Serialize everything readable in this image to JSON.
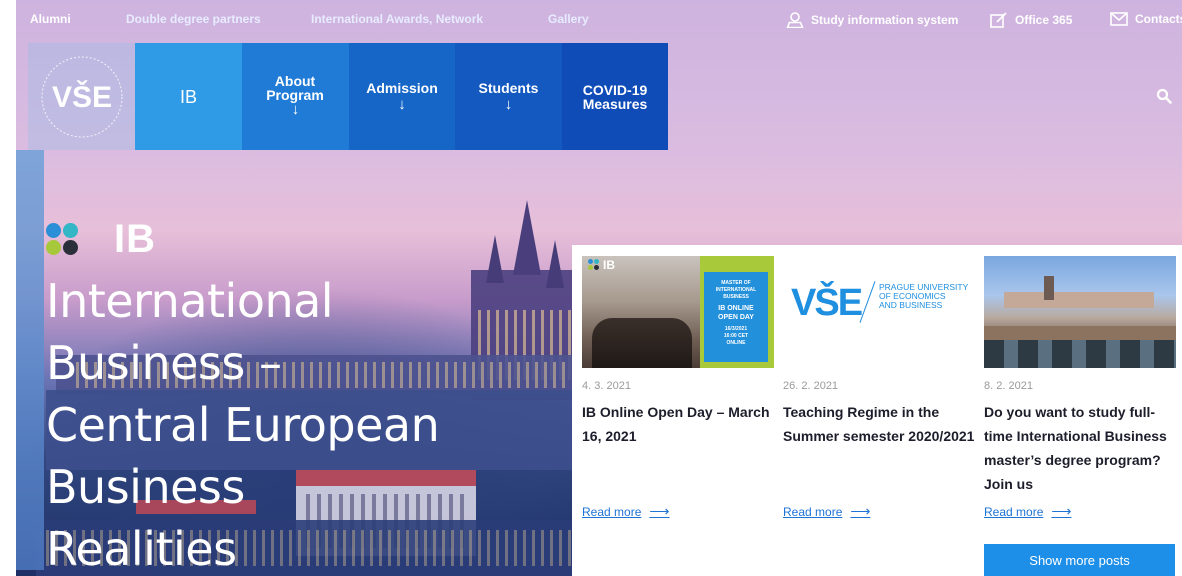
{
  "topbar": {
    "left_links": [
      "Alumni",
      "Double degree partners",
      "International Awards, Network",
      "Gallery"
    ],
    "right_links": [
      {
        "label": "Study information system",
        "icon": "user-icon"
      },
      {
        "label": "Office 365",
        "icon": "edit-icon"
      },
      {
        "label": "Contacts",
        "icon": "mail-icon"
      }
    ]
  },
  "logo": {
    "text": "VŠE",
    "ring_text": "UNIVERSITY OF ECONOMICS AND BUSINESS · PRAGUE"
  },
  "nav": {
    "items": [
      {
        "label": "IB",
        "arrow": ""
      },
      {
        "label": "About Program",
        "arrow": "↓"
      },
      {
        "label": "Admission",
        "arrow": "↓"
      },
      {
        "label": "Students",
        "arrow": "↓"
      },
      {
        "label": "COVID-19 Measures",
        "arrow": ""
      }
    ],
    "search_icon": "search-icon"
  },
  "hero": {
    "badge": "IB",
    "title_lines": [
      "International",
      "Business –",
      "Central European",
      "Business",
      "Realities"
    ]
  },
  "news": {
    "items": [
      {
        "date": "4. 3. 2021",
        "title": "IB Online Open Day – March 16, 2021",
        "link": "Read more",
        "thumb_badge": "IB",
        "thumb_panel_lines": [
          "MASTER OF",
          "INTERNATIONAL",
          "BUSINESS",
          "IB ONLINE",
          "OPEN DAY",
          "16/3/2021",
          "16:00 CET",
          "ONLINE"
        ]
      },
      {
        "date": "26. 2. 2021",
        "title": "Teaching Regime in the Summer semester 2020/2021",
        "link": "Read more",
        "thumb_logo": "VŠE",
        "thumb_logo_text": [
          "PRAGUE UNIVERSITY",
          "OF ECONOMICS",
          "AND BUSINESS"
        ]
      },
      {
        "date": "8. 2. 2021",
        "title": "Do you want to study full-time International Business master’s degree program? Join us",
        "link": "Read more"
      }
    ],
    "show_more": "Show more posts"
  },
  "colors": {
    "nav_ib": "#2f9ae6",
    "nav_dark": "#0f4cb7",
    "link": "#1e73d6",
    "button": "#1e8fe8",
    "dot_blue": "#2a8fd6",
    "dot_teal": "#33b6c6",
    "dot_green": "#a7c83a",
    "dot_dark": "#2b2f3a"
  }
}
